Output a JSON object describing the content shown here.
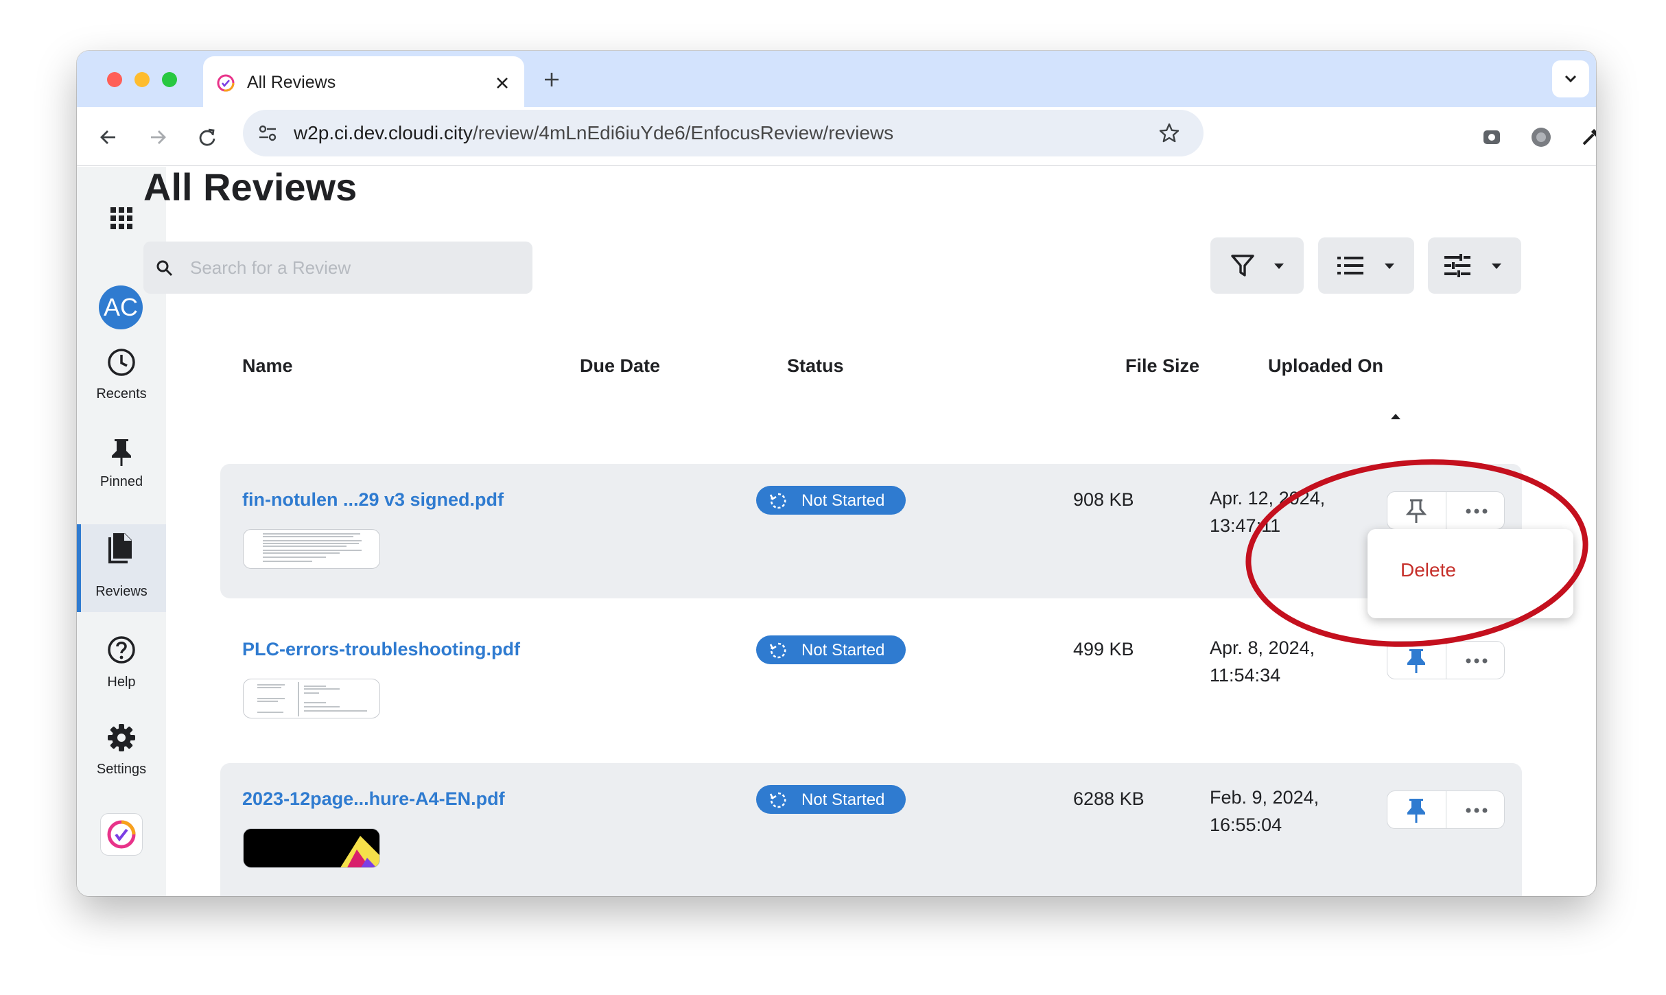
{
  "browser": {
    "tab_title": "All Reviews",
    "url_host": "w2p.ci.dev.cloudi.city",
    "url_path": "/review/4mLnEdi6iuYde6/EnfocusReview/reviews"
  },
  "sidebar": {
    "avatar_initials": "AC",
    "items": [
      {
        "label": "Recents",
        "icon": "clock-icon"
      },
      {
        "label": "Pinned",
        "icon": "pin-icon"
      },
      {
        "label": "Reviews",
        "icon": "documents-icon",
        "selected": true
      },
      {
        "label": "Help",
        "icon": "help-icon"
      },
      {
        "label": "Settings",
        "icon": "gear-icon"
      }
    ]
  },
  "page": {
    "title": "All Reviews",
    "search_placeholder": "Search for a Review"
  },
  "table": {
    "columns": [
      "Name",
      "Due Date",
      "Status",
      "File Size",
      "Uploaded On"
    ],
    "sort_column": "Uploaded On",
    "rows": [
      {
        "name": "fin-notulen ...29 v3 signed.pdf",
        "status": "Not Started",
        "size": "908 KB",
        "date_line1": "Apr. 12, 2024,",
        "date_line2": "13:47:11",
        "pinned": false
      },
      {
        "name": "PLC-errors-troubleshooting.pdf",
        "status": "Not Started",
        "size": "499 KB",
        "date_line1": "Apr. 8, 2024,",
        "date_line2": "11:54:34",
        "pinned": true
      },
      {
        "name": "2023-12page...hure-A4-EN.pdf",
        "status": "Not Started",
        "size": "6288 KB",
        "date_line1": "Feb. 9, 2024,",
        "date_line2": "16:55:04",
        "pinned": true
      }
    ]
  },
  "context_menu": {
    "delete_label": "Delete"
  },
  "colors": {
    "accent": "#2f7bd0",
    "danger": "#c6302b",
    "annotation": "#c4101e",
    "tabstrip": "#d3e3fd"
  }
}
